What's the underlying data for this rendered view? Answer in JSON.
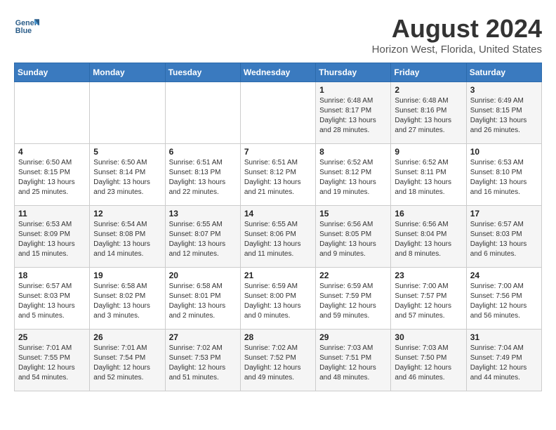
{
  "header": {
    "logo_line1": "General",
    "logo_line2": "Blue",
    "title": "August 2024",
    "subtitle": "Horizon West, Florida, United States"
  },
  "weekdays": [
    "Sunday",
    "Monday",
    "Tuesday",
    "Wednesday",
    "Thursday",
    "Friday",
    "Saturday"
  ],
  "weeks": [
    [
      {
        "day": "",
        "sunrise": "",
        "sunset": "",
        "daylight": ""
      },
      {
        "day": "",
        "sunrise": "",
        "sunset": "",
        "daylight": ""
      },
      {
        "day": "",
        "sunrise": "",
        "sunset": "",
        "daylight": ""
      },
      {
        "day": "",
        "sunrise": "",
        "sunset": "",
        "daylight": ""
      },
      {
        "day": "1",
        "sunrise": "Sunrise: 6:48 AM",
        "sunset": "Sunset: 8:17 PM",
        "daylight": "Daylight: 13 hours and 28 minutes."
      },
      {
        "day": "2",
        "sunrise": "Sunrise: 6:48 AM",
        "sunset": "Sunset: 8:16 PM",
        "daylight": "Daylight: 13 hours and 27 minutes."
      },
      {
        "day": "3",
        "sunrise": "Sunrise: 6:49 AM",
        "sunset": "Sunset: 8:15 PM",
        "daylight": "Daylight: 13 hours and 26 minutes."
      }
    ],
    [
      {
        "day": "4",
        "sunrise": "Sunrise: 6:50 AM",
        "sunset": "Sunset: 8:15 PM",
        "daylight": "Daylight: 13 hours and 25 minutes."
      },
      {
        "day": "5",
        "sunrise": "Sunrise: 6:50 AM",
        "sunset": "Sunset: 8:14 PM",
        "daylight": "Daylight: 13 hours and 23 minutes."
      },
      {
        "day": "6",
        "sunrise": "Sunrise: 6:51 AM",
        "sunset": "Sunset: 8:13 PM",
        "daylight": "Daylight: 13 hours and 22 minutes."
      },
      {
        "day": "7",
        "sunrise": "Sunrise: 6:51 AM",
        "sunset": "Sunset: 8:12 PM",
        "daylight": "Daylight: 13 hours and 21 minutes."
      },
      {
        "day": "8",
        "sunrise": "Sunrise: 6:52 AM",
        "sunset": "Sunset: 8:12 PM",
        "daylight": "Daylight: 13 hours and 19 minutes."
      },
      {
        "day": "9",
        "sunrise": "Sunrise: 6:52 AM",
        "sunset": "Sunset: 8:11 PM",
        "daylight": "Daylight: 13 hours and 18 minutes."
      },
      {
        "day": "10",
        "sunrise": "Sunrise: 6:53 AM",
        "sunset": "Sunset: 8:10 PM",
        "daylight": "Daylight: 13 hours and 16 minutes."
      }
    ],
    [
      {
        "day": "11",
        "sunrise": "Sunrise: 6:53 AM",
        "sunset": "Sunset: 8:09 PM",
        "daylight": "Daylight: 13 hours and 15 minutes."
      },
      {
        "day": "12",
        "sunrise": "Sunrise: 6:54 AM",
        "sunset": "Sunset: 8:08 PM",
        "daylight": "Daylight: 13 hours and 14 minutes."
      },
      {
        "day": "13",
        "sunrise": "Sunrise: 6:55 AM",
        "sunset": "Sunset: 8:07 PM",
        "daylight": "Daylight: 13 hours and 12 minutes."
      },
      {
        "day": "14",
        "sunrise": "Sunrise: 6:55 AM",
        "sunset": "Sunset: 8:06 PM",
        "daylight": "Daylight: 13 hours and 11 minutes."
      },
      {
        "day": "15",
        "sunrise": "Sunrise: 6:56 AM",
        "sunset": "Sunset: 8:05 PM",
        "daylight": "Daylight: 13 hours and 9 minutes."
      },
      {
        "day": "16",
        "sunrise": "Sunrise: 6:56 AM",
        "sunset": "Sunset: 8:04 PM",
        "daylight": "Daylight: 13 hours and 8 minutes."
      },
      {
        "day": "17",
        "sunrise": "Sunrise: 6:57 AM",
        "sunset": "Sunset: 8:03 PM",
        "daylight": "Daylight: 13 hours and 6 minutes."
      }
    ],
    [
      {
        "day": "18",
        "sunrise": "Sunrise: 6:57 AM",
        "sunset": "Sunset: 8:03 PM",
        "daylight": "Daylight: 13 hours and 5 minutes."
      },
      {
        "day": "19",
        "sunrise": "Sunrise: 6:58 AM",
        "sunset": "Sunset: 8:02 PM",
        "daylight": "Daylight: 13 hours and 3 minutes."
      },
      {
        "day": "20",
        "sunrise": "Sunrise: 6:58 AM",
        "sunset": "Sunset: 8:01 PM",
        "daylight": "Daylight: 13 hours and 2 minutes."
      },
      {
        "day": "21",
        "sunrise": "Sunrise: 6:59 AM",
        "sunset": "Sunset: 8:00 PM",
        "daylight": "Daylight: 13 hours and 0 minutes."
      },
      {
        "day": "22",
        "sunrise": "Sunrise: 6:59 AM",
        "sunset": "Sunset: 7:59 PM",
        "daylight": "Daylight: 12 hours and 59 minutes."
      },
      {
        "day": "23",
        "sunrise": "Sunrise: 7:00 AM",
        "sunset": "Sunset: 7:57 PM",
        "daylight": "Daylight: 12 hours and 57 minutes."
      },
      {
        "day": "24",
        "sunrise": "Sunrise: 7:00 AM",
        "sunset": "Sunset: 7:56 PM",
        "daylight": "Daylight: 12 hours and 56 minutes."
      }
    ],
    [
      {
        "day": "25",
        "sunrise": "Sunrise: 7:01 AM",
        "sunset": "Sunset: 7:55 PM",
        "daylight": "Daylight: 12 hours and 54 minutes."
      },
      {
        "day": "26",
        "sunrise": "Sunrise: 7:01 AM",
        "sunset": "Sunset: 7:54 PM",
        "daylight": "Daylight: 12 hours and 52 minutes."
      },
      {
        "day": "27",
        "sunrise": "Sunrise: 7:02 AM",
        "sunset": "Sunset: 7:53 PM",
        "daylight": "Daylight: 12 hours and 51 minutes."
      },
      {
        "day": "28",
        "sunrise": "Sunrise: 7:02 AM",
        "sunset": "Sunset: 7:52 PM",
        "daylight": "Daylight: 12 hours and 49 minutes."
      },
      {
        "day": "29",
        "sunrise": "Sunrise: 7:03 AM",
        "sunset": "Sunset: 7:51 PM",
        "daylight": "Daylight: 12 hours and 48 minutes."
      },
      {
        "day": "30",
        "sunrise": "Sunrise: 7:03 AM",
        "sunset": "Sunset: 7:50 PM",
        "daylight": "Daylight: 12 hours and 46 minutes."
      },
      {
        "day": "31",
        "sunrise": "Sunrise: 7:04 AM",
        "sunset": "Sunset: 7:49 PM",
        "daylight": "Daylight: 12 hours and 44 minutes."
      }
    ]
  ]
}
